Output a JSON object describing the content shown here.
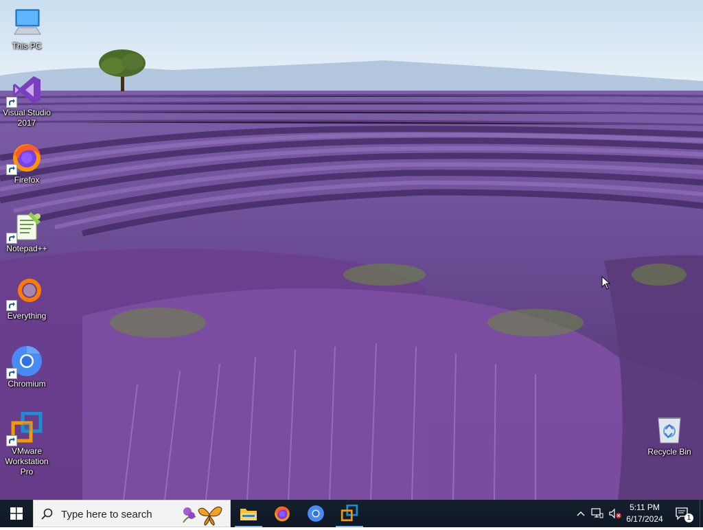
{
  "desktop": {
    "icons": [
      {
        "label": "This PC"
      },
      {
        "label": "Visual Studio\n2017"
      },
      {
        "label": "Firefox"
      },
      {
        "label": "Notepad++"
      },
      {
        "label": "Everything"
      },
      {
        "label": "Chromium"
      },
      {
        "label": "VMware\nWorkstation\nPro"
      },
      {
        "label": "Recycle Bin"
      }
    ]
  },
  "taskbar": {
    "search_placeholder": "Type here to search",
    "pinned_apps": [
      "file-explorer",
      "firefox",
      "chromium",
      "vmware-workstation"
    ],
    "clock": {
      "time": "5:11 PM",
      "date": "6/17/2024"
    },
    "notification_count": "1"
  },
  "colors": {
    "taskbar_bg": "#101a29",
    "search_bg": "#f3f3f3",
    "active_underline": "#76b9ed"
  }
}
